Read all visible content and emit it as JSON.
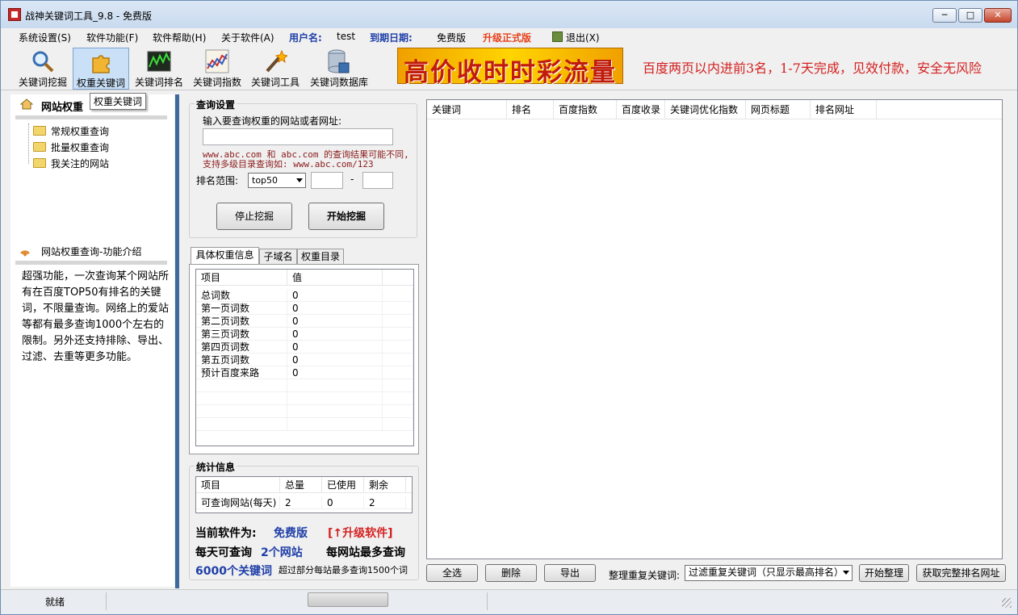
{
  "window": {
    "title": "战神关键词工具_9.8 - 免费版"
  },
  "menu": {
    "items": [
      "系统设置(S)",
      "软件功能(F)",
      "软件帮助(H)",
      "关于软件(A)"
    ],
    "user_label": "用户名:",
    "user_value": "test",
    "expire_label": "到期日期:",
    "expire_value": "免费版",
    "upgrade": "升级正式版",
    "exit": "退出(X)"
  },
  "toolbar": {
    "buttons": [
      "关键词挖掘",
      "权重关键词",
      "关键词排名",
      "关键词指数",
      "关键词工具",
      "关键词数据库"
    ],
    "banner": "高价收时时彩流量",
    "marquee": "百度两页以内进前3名，1-7天完成，见效付款，安全无风险"
  },
  "tooltip": "权重关键词",
  "left": {
    "title": "网站权重",
    "tree": [
      "常规权重查询",
      "批量权重查询",
      "我关注的网站"
    ],
    "intro_title": "网站权重查询-功能介绍",
    "intro_text": "超强功能，一次查询某个网站所有在百度TOP50有排名的关键词，不限量查询。网络上的爱站等都有最多查询1000个左右的限制。另外还支持排除、导出、过滤、去重等更多功能。"
  },
  "query": {
    "group_title": "查询设置",
    "prompt": "输入要查询权重的网站或者网址:",
    "url_value": "",
    "note1": "www.abc.com 和 abc.com 的查询结果可能不同,",
    "note2": "支持多级目录查询如: www.abc.com/123",
    "range_label": "排名范围:",
    "range_value": "top50",
    "range_dash": "-",
    "stop_btn": "停止挖掘",
    "start_btn": "开始挖掘"
  },
  "tabs": [
    "具体权重信息",
    "子域名",
    "权重目录"
  ],
  "weight_grid": {
    "columns": [
      "项目",
      "值"
    ],
    "rows": [
      [
        "总词数",
        "0"
      ],
      [
        "第一页词数",
        "0"
      ],
      [
        "第二页词数",
        "0"
      ],
      [
        "第三页词数",
        "0"
      ],
      [
        "第四页词数",
        "0"
      ],
      [
        "第五页词数",
        "0"
      ],
      [
        "预计百度来路",
        "0"
      ]
    ]
  },
  "stats": {
    "group_title": "统计信息",
    "columns": [
      "项目",
      "总量",
      "已使用",
      "剩余"
    ],
    "rows": [
      [
        "可查询网站(每天)",
        "2",
        "0",
        "2"
      ]
    ],
    "current_label": "当前软件为:",
    "current_value": "免费版",
    "upgrade_link": "[↑升级软件]",
    "daily_label": "每天可查询",
    "daily_value": "2个网站",
    "max_label": "每网站最多查询",
    "max_value": "6000个关键词",
    "over_note": "超过部分每站最多查询1500个词"
  },
  "results": {
    "columns": [
      "关键词",
      "排名",
      "百度指数",
      "百度收录",
      "关键词优化指数",
      "网页标题",
      "排名网址"
    ]
  },
  "bottom": {
    "select_all": "全选",
    "delete": "删除",
    "export": "导出",
    "dedupe_label": "整理重复关键词:",
    "dedupe_value": "过滤重复关键词（只显示最高排名）",
    "start_dedupe": "开始整理",
    "get_urls": "获取完整排名网址"
  },
  "status": {
    "text": "就绪"
  }
}
